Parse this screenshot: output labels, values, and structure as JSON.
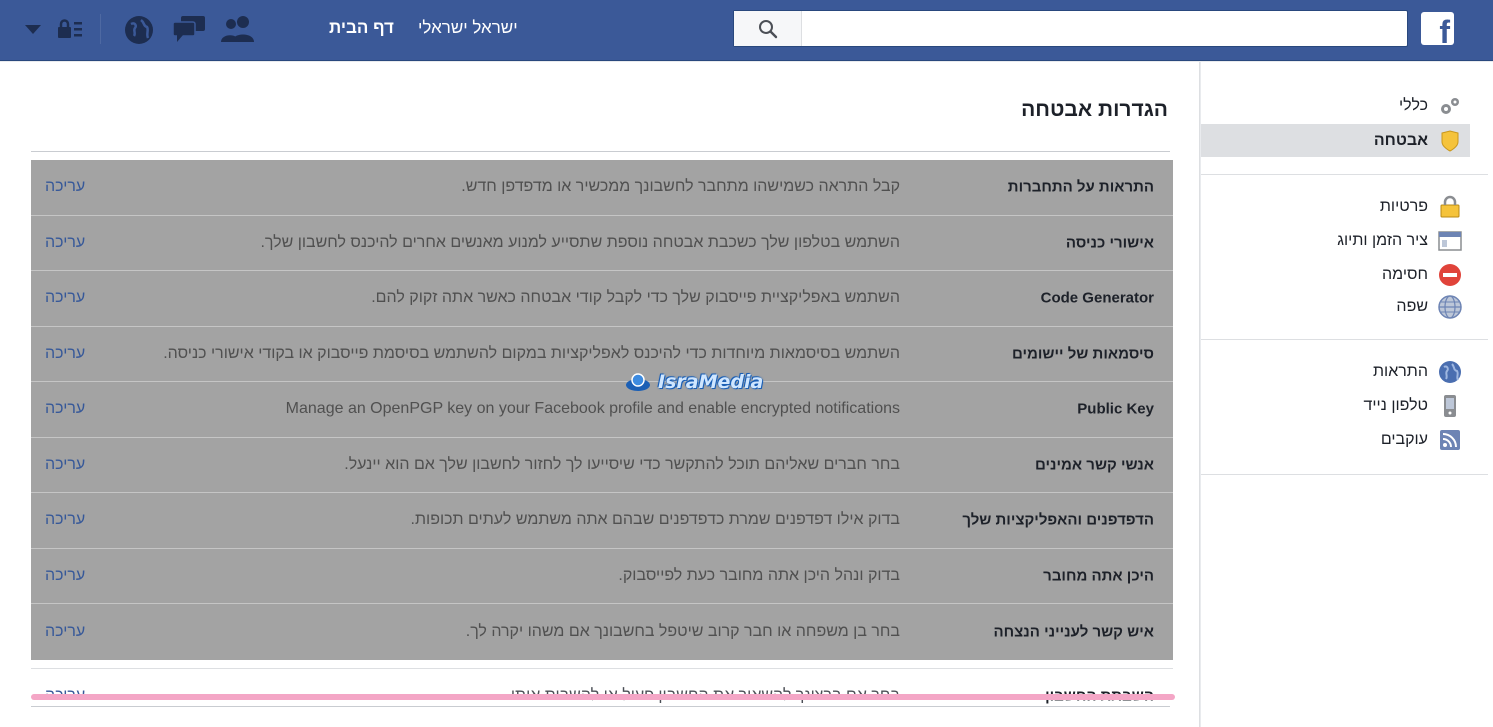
{
  "header": {
    "home_label": "דף הבית",
    "user_name": "ישראל ישראלי",
    "search_placeholder": "",
    "logo_letter": "f"
  },
  "page": {
    "title": "הגדרות אבטחה"
  },
  "rows": [
    {
      "title": "התראות על התחברות",
      "desc": "קבל התראה כשמישהו מתחבר לחשבונך ממכשיר או מדפדפן חדש.",
      "edit": "עריכה"
    },
    {
      "title": "אישורי כניסה",
      "desc": "השתמש בטלפון שלך כשכבת אבטחה נוספת שתסייע למנוע מאנשים אחרים להיכנס לחשבון שלך.",
      "edit": "עריכה"
    },
    {
      "title": "Code Generator",
      "desc": "השתמש באפליקציית פייסבוק שלך כדי לקבל קודי אבטחה כאשר אתה זקוק להם.",
      "edit": "עריכה"
    },
    {
      "title": "סיסמאות של יישומים",
      "desc": "השתמש בסיסמאות מיוחדות כדי להיכנס לאפליקציות במקום להשתמש בסיסמת פייסבוק או בקודי אישורי כניסה.",
      "edit": "עריכה"
    },
    {
      "title": "Public Key",
      "desc": "Manage an OpenPGP key on your Facebook profile and enable encrypted notifications",
      "edit": "עריכה"
    },
    {
      "title": "אנשי קשר אמינים",
      "desc": "בחר חברים שאליהם תוכל להתקשר כדי שיסייעו לך לחזור לחשבון שלך אם הוא יינעל.",
      "edit": "עריכה"
    },
    {
      "title": "הדפדפנים והאפליקציות שלך",
      "desc": "בדוק אילו דפדפנים שמרת כדפדפנים שבהם אתה משתמש לעתים תכופות.",
      "edit": "עריכה"
    },
    {
      "title": "היכן אתה מחובר",
      "desc": "בדוק ונהל היכן אתה מחובר כעת לפייסבוק.",
      "edit": "עריכה"
    },
    {
      "title": "איש קשר לענייני הנצחה",
      "desc": "בחר בן משפחה או חבר קרוב שיטפל בחשבונך אם משהו יקרה לך.",
      "edit": "עריכה"
    }
  ],
  "deactivate": {
    "title": "השבתת החשבון",
    "desc": "בחר אם ברצונך להשאיר את החשבון פעיל או להשבית אותו.",
    "edit": "עריכה"
  },
  "watermark": "IsraMedia",
  "sidebar": {
    "group1": [
      {
        "label": "כללי",
        "icon": "gears-icon"
      },
      {
        "label": "אבטחה",
        "icon": "shield-icon",
        "active": true
      }
    ],
    "group2": [
      {
        "label": "פרטיות",
        "icon": "lock-icon"
      },
      {
        "label": "ציר הזמן ותיוג",
        "icon": "timeline-icon"
      },
      {
        "label": "חסימה",
        "icon": "block-icon"
      },
      {
        "label": "שפה",
        "icon": "globe-icon"
      }
    ],
    "group3": [
      {
        "label": "התראות",
        "icon": "world-icon"
      },
      {
        "label": "טלפון נייד",
        "icon": "mobile-icon"
      },
      {
        "label": "עוקבים",
        "icon": "rss-icon"
      }
    ]
  },
  "colors": {
    "brand": "#3b5998",
    "link": "#365899",
    "dim_overlay": "#a3a3a3",
    "highlight": "#f4a6c6"
  }
}
